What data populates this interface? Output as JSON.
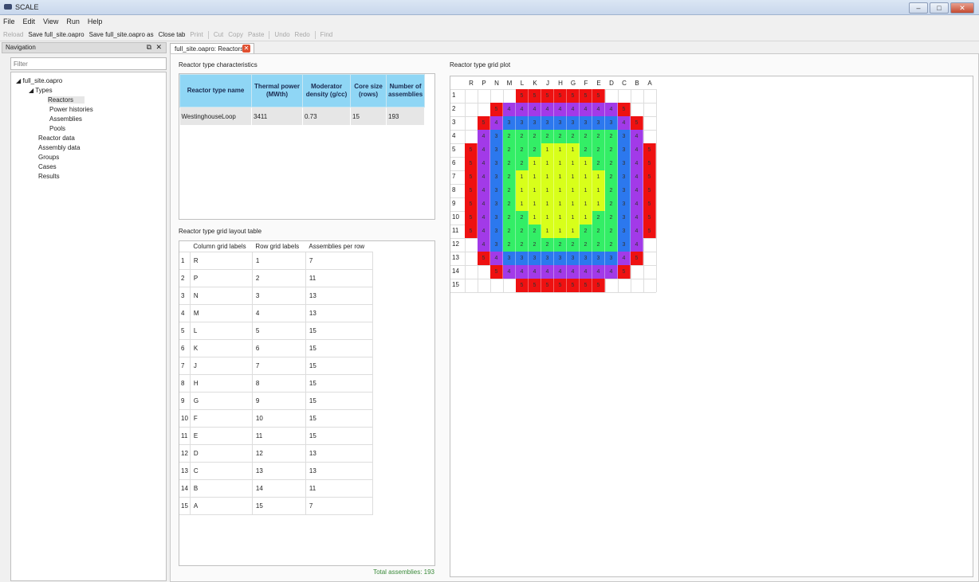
{
  "window": {
    "title": "SCALE"
  },
  "menu": [
    "File",
    "Edit",
    "View",
    "Run",
    "Help"
  ],
  "toolbar": {
    "reload": "Reload",
    "save": "Save full_site.oapro",
    "save_as": "Save full_site.oapro as",
    "close_tab": "Close tab",
    "print": "Print",
    "cut": "Cut",
    "copy": "Copy",
    "paste": "Paste",
    "undo": "Undo",
    "redo": "Redo",
    "find": "Find"
  },
  "navigation": {
    "header": "Navigation",
    "filter_placeholder": "Filter",
    "tree": {
      "root": "full_site.oapro",
      "types": "Types",
      "reactors": "Reactors",
      "power_histories": "Power histories",
      "assemblies": "Assemblies",
      "pools": "Pools",
      "reactor_data": "Reactor data",
      "assembly_data": "Assembly data",
      "groups": "Groups",
      "cases": "Cases",
      "results": "Results"
    }
  },
  "tab": {
    "label": "full_site.oapro: Reactors"
  },
  "characteristics": {
    "label": "Reactor type characteristics",
    "headers": {
      "name": "Reactor type name",
      "power": "Thermal power (MWth)",
      "density": "Moderator density (g/cc)",
      "core": "Core size (rows)",
      "count": "Number of assemblies"
    },
    "row": {
      "name": "WestinghouseLoop",
      "power": "3411",
      "density": "0.73",
      "core": "15",
      "count": "193"
    }
  },
  "layout_table": {
    "label": "Reactor type grid layout table",
    "headers": {
      "col": "Column grid labels",
      "row": "Row grid labels",
      "per": "Assemblies per row"
    },
    "rows": [
      {
        "n": "1",
        "col": "R",
        "row": "1",
        "per": "7"
      },
      {
        "n": "2",
        "col": "P",
        "row": "2",
        "per": "11"
      },
      {
        "n": "3",
        "col": "N",
        "row": "3",
        "per": "13"
      },
      {
        "n": "4",
        "col": "M",
        "row": "4",
        "per": "13"
      },
      {
        "n": "5",
        "col": "L",
        "row": "5",
        "per": "15"
      },
      {
        "n": "6",
        "col": "K",
        "row": "6",
        "per": "15"
      },
      {
        "n": "7",
        "col": "J",
        "row": "7",
        "per": "15"
      },
      {
        "n": "8",
        "col": "H",
        "row": "8",
        "per": "15"
      },
      {
        "n": "9",
        "col": "G",
        "row": "9",
        "per": "15"
      },
      {
        "n": "10",
        "col": "F",
        "row": "10",
        "per": "15"
      },
      {
        "n": "11",
        "col": "E",
        "row": "11",
        "per": "15"
      },
      {
        "n": "12",
        "col": "D",
        "row": "12",
        "per": "13"
      },
      {
        "n": "13",
        "col": "C",
        "row": "13",
        "per": "13"
      },
      {
        "n": "14",
        "col": "B",
        "row": "14",
        "per": "11"
      },
      {
        "n": "15",
        "col": "A",
        "row": "15",
        "per": "7"
      }
    ],
    "total": "Total assemblies: 193"
  },
  "plot": {
    "label": "Reactor type grid plot",
    "columns": [
      "R",
      "P",
      "N",
      "M",
      "L",
      "K",
      "J",
      "H",
      "G",
      "F",
      "E",
      "D",
      "C",
      "B",
      "A"
    ],
    "rows": [
      "1",
      "2",
      "3",
      "4",
      "5",
      "6",
      "7",
      "8",
      "9",
      "10",
      "11",
      "12",
      "13",
      "14",
      "15"
    ],
    "colors": {
      "5": "#ee1111",
      "4": "#a23ae8",
      "3": "#2c78ee",
      "2": "#33ee66",
      "1": "#d8ff1a"
    },
    "map": [
      "....5555555....",
      "..54444444445..",
      ".5433333333345.",
      ".4322222222234.",
      "543222111222345",
      "543221111122345",
      "543211111112345",
      "543211111112345",
      "543211111112345",
      "543221111122345",
      "543222111222345",
      ".4322222222234.",
      ".5433333333345.",
      "..54444444445..",
      "....5555555...."
    ]
  }
}
